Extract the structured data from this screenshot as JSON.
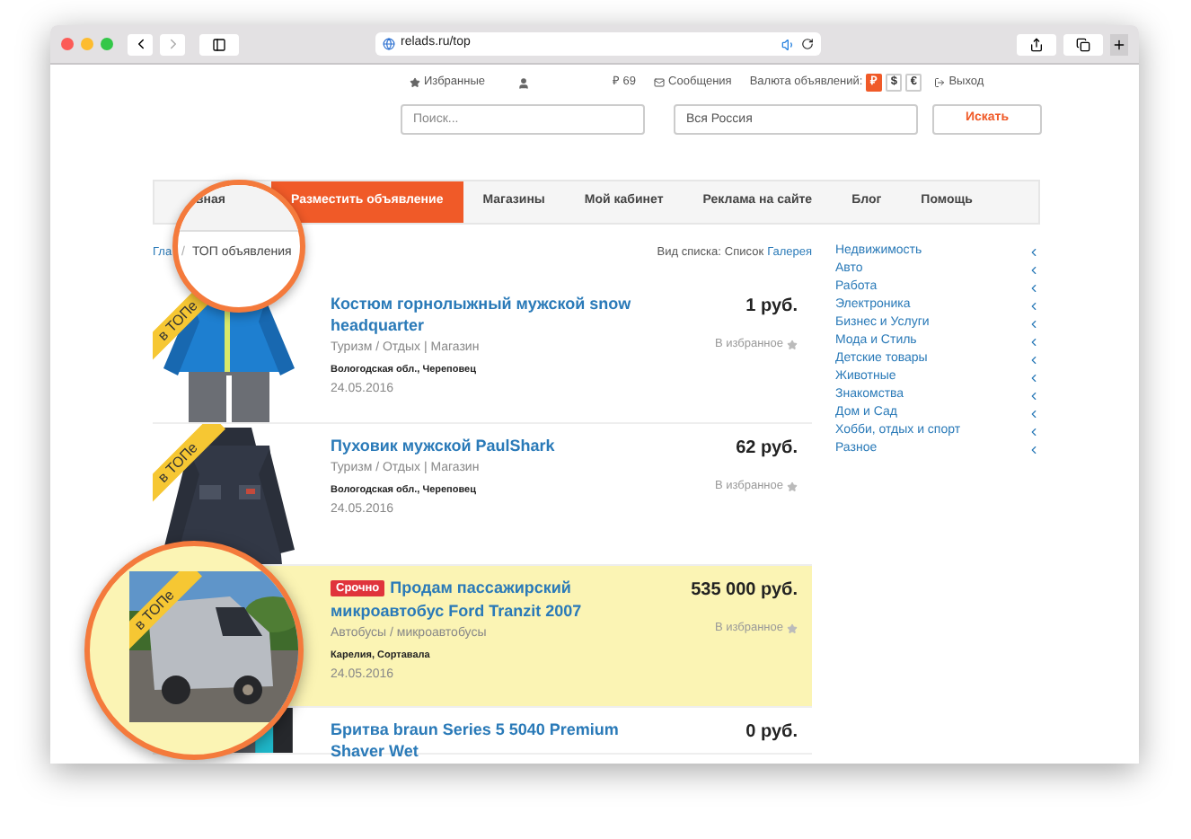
{
  "browser": {
    "url": "relads.ru/top"
  },
  "header": {
    "favorites": "Избранные",
    "balance": "₽ 69",
    "messages": "Сообщения",
    "currency_label": "Валюта объявлений:",
    "logout": "Выход",
    "currencies": [
      {
        "label": "₽",
        "selected": true
      },
      {
        "label": "$",
        "selected": false
      },
      {
        "label": "€",
        "selected": false
      }
    ]
  },
  "search": {
    "placeholder": "Поиск...",
    "region": "Вся Россия",
    "button": "Искать"
  },
  "tabs": [
    {
      "label": "Разместить объявление",
      "selected": true
    },
    {
      "label": "Магазины",
      "selected": false
    },
    {
      "label": "Мой кабинет",
      "selected": false
    },
    {
      "label": "Реклама на сайте",
      "selected": false
    },
    {
      "label": "Блог",
      "selected": false
    },
    {
      "label": "Помощь",
      "selected": false
    }
  ],
  "breadcrumb": "Гла",
  "view": {
    "label": "Вид списка:",
    "options": [
      {
        "label": "Список",
        "selected": true
      },
      {
        "label": "Галерея",
        "selected": false
      }
    ]
  },
  "listings": [
    {
      "title": "Костюм горнолыжный мужской snow headquarter",
      "category": "Туризм / Отдых | Магазин",
      "location": "Вологодская обл., Череповец",
      "date": "24.05.2016",
      "price": "1 руб.",
      "favorite": "В избранное",
      "badge": "в ТОПе",
      "highlighted": false
    },
    {
      "title": "Пуховик мужской PaulShark",
      "category": "Туризм / Отдых | Магазин",
      "location": "Вологодская обл., Череповец",
      "date": "24.05.2016",
      "price": "62 руб.",
      "favorite": "В избранное",
      "badge": "в ТОПе",
      "highlighted": false
    },
    {
      "tag": "Срочно",
      "title": "Продам пассажирский микроавтобус Ford Tranzit 2007",
      "category": "Автобусы / микроавтобусы",
      "location": "Карелия, Сортавала",
      "date": "24.05.2016",
      "price": "535 000 руб.",
      "favorite": "В избранное",
      "highlighted": true
    },
    {
      "title": "Бритва braun Series 5 5040 Premium Shaver Wet",
      "price": "0 руб.",
      "highlighted": false
    }
  ],
  "categories": [
    "Недвижимость",
    "Авто",
    "Работа",
    "Электроника",
    "Бизнес и Услуги",
    "Мода и Стиль",
    "Детские товары",
    "Животные",
    "Знакомства",
    "Дом и Сад",
    "Хобби, отдых и спорт",
    "Разное"
  ],
  "lenses": [
    {
      "tab_fragment": "вная",
      "separator": "/",
      "crumb": "ТОП объявления"
    },
    {
      "badge": "в ТОПе"
    }
  ]
}
